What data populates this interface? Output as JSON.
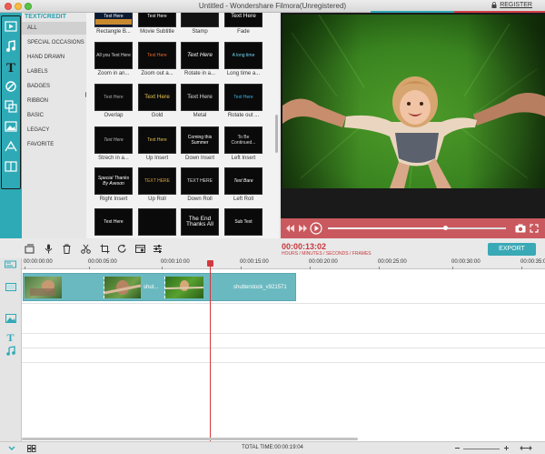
{
  "window": {
    "title": "Untitled - Wondershare Filmora(Unregistered)",
    "register_label": "REGISTER"
  },
  "categories": {
    "header": "TEXT/CREDIT",
    "items": [
      "ALL",
      "SPECIAL OCCASIONS",
      "HAND DRAWN",
      "LABELS",
      "BADGES",
      "RIBBON",
      "BASIC",
      "LEGACY",
      "FAVORITE"
    ],
    "selected": "ALL"
  },
  "thumbnails": [
    {
      "label": "Rectangle B...",
      "text": "Text Here"
    },
    {
      "label": "Movie Subtitle",
      "text": "Text Here"
    },
    {
      "label": "Stamp",
      "text": ""
    },
    {
      "label": "Fade",
      "text": "Text Here"
    },
    {
      "label": "Zoom in an...",
      "text": "All you Text Here"
    },
    {
      "label": "Zoom out a...",
      "text": "Text Here"
    },
    {
      "label": "Rotate in a...",
      "text": "Text Here"
    },
    {
      "label": "Long time a...",
      "text": "A long time"
    },
    {
      "label": "Overlap",
      "text": "Text Here"
    },
    {
      "label": "Gold",
      "text": "Text Here"
    },
    {
      "label": "Metal",
      "text": "Text Here"
    },
    {
      "label": "Rotate out ...",
      "text": "Text Here"
    },
    {
      "label": "Strech in a...",
      "text": "Text Here"
    },
    {
      "label": "Up Insert",
      "text": "Text Here"
    },
    {
      "label": "Down Insert",
      "text": "Coming this Summer"
    },
    {
      "label": "Left Insert",
      "text": "To Be Continued..."
    },
    {
      "label": "Right Insert",
      "text": "Special Thanks By Aveson"
    },
    {
      "label": "Up Roll",
      "text": "TEXT HERE"
    },
    {
      "label": "Down Roll",
      "text": "TEXT HERE"
    },
    {
      "label": "Left Roll",
      "text": "Text Bare"
    },
    {
      "label": "",
      "text": "Text Here"
    },
    {
      "label": "",
      "text": ""
    },
    {
      "label": "",
      "text": "The End Thanks All"
    },
    {
      "label": "",
      "text": "Sub Text"
    }
  ],
  "preview": {
    "timecode": "00:00:13:02",
    "time_units": "HOURS / MINUTES / SECONDS / FRAMES",
    "progress": 0.66
  },
  "toolbar": {
    "export_label": "EXPORT"
  },
  "ruler": [
    "00:00:00:00",
    "00:00:05:00",
    "00:00:10:00",
    "00:00:15:00",
    "00:00:20:00",
    "00:00:25:00",
    "00:00:30:00",
    "00:00:35:00"
  ],
  "timeline": {
    "clip2_label": "shut...",
    "clip3_label": "shutterstock_v921571"
  },
  "status": {
    "total_time": "TOTAL TIME:00:00:19:04"
  },
  "colors": {
    "accent": "#2eaab6",
    "timecode": "#c9373d",
    "playbar": "#c9595e"
  }
}
